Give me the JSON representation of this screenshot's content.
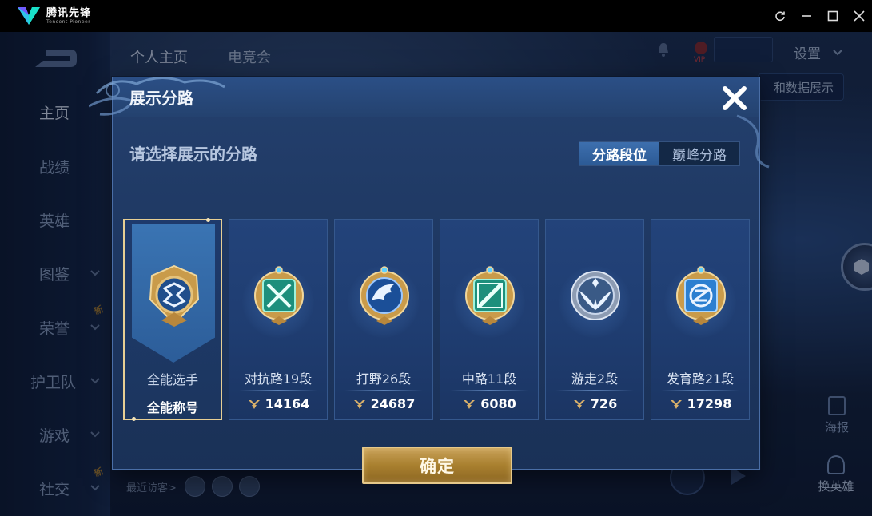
{
  "emulator": {
    "brand_cn": "腾讯先锋",
    "brand_en": "Tencent Pioneer",
    "buttons": [
      "refresh-icon",
      "minimize-icon",
      "maximize-icon",
      "close-icon"
    ]
  },
  "background": {
    "nav_items": [
      {
        "label": "主页",
        "active": true
      },
      {
        "label": "战绩"
      },
      {
        "label": "英雄"
      },
      {
        "label": "图鉴",
        "chevron": true
      },
      {
        "label": "荣誉",
        "chevron": true,
        "new_tag": "新"
      },
      {
        "label": "护卫队",
        "chevron": true
      },
      {
        "label": "游戏",
        "chevron": true
      },
      {
        "label": "社交",
        "chevron": true,
        "new_tag": "新"
      }
    ],
    "top_tabs": [
      "个人主页",
      "电竞会"
    ],
    "settings_label": "设置",
    "data_button_label": "和数据展示",
    "poster_label": "海报",
    "change_hero_label": "换英雄",
    "recent_visitors_label": "最近访客>"
  },
  "dialog": {
    "title": "展示分路",
    "subtitle": "请选择展示的分路",
    "segments": [
      {
        "label": "分路段位",
        "active": true
      },
      {
        "label": "巅峰分路",
        "active": false
      }
    ],
    "cards": [
      {
        "label": "全能选手",
        "value": "全能称号",
        "selected": true,
        "icon": "all-round-emblem-icon"
      },
      {
        "label": "对抗路19段",
        "value": "14164",
        "icon": "clash-lane-emblem-icon"
      },
      {
        "label": "打野26段",
        "value": "24687",
        "icon": "jungle-emblem-icon"
      },
      {
        "label": "中路11段",
        "value": "6080",
        "icon": "mid-lane-emblem-icon"
      },
      {
        "label": "游走2段",
        "value": "726",
        "icon": "roam-emblem-icon"
      },
      {
        "label": "发育路21段",
        "value": "17298",
        "icon": "farm-lane-emblem-icon"
      }
    ],
    "confirm_label": "确定"
  },
  "colors": {
    "dialog_bg": "#1d365f",
    "accent_blue": "#3d6fae",
    "gold": "#c9a25a",
    "selected_border": "#e7cf94"
  }
}
